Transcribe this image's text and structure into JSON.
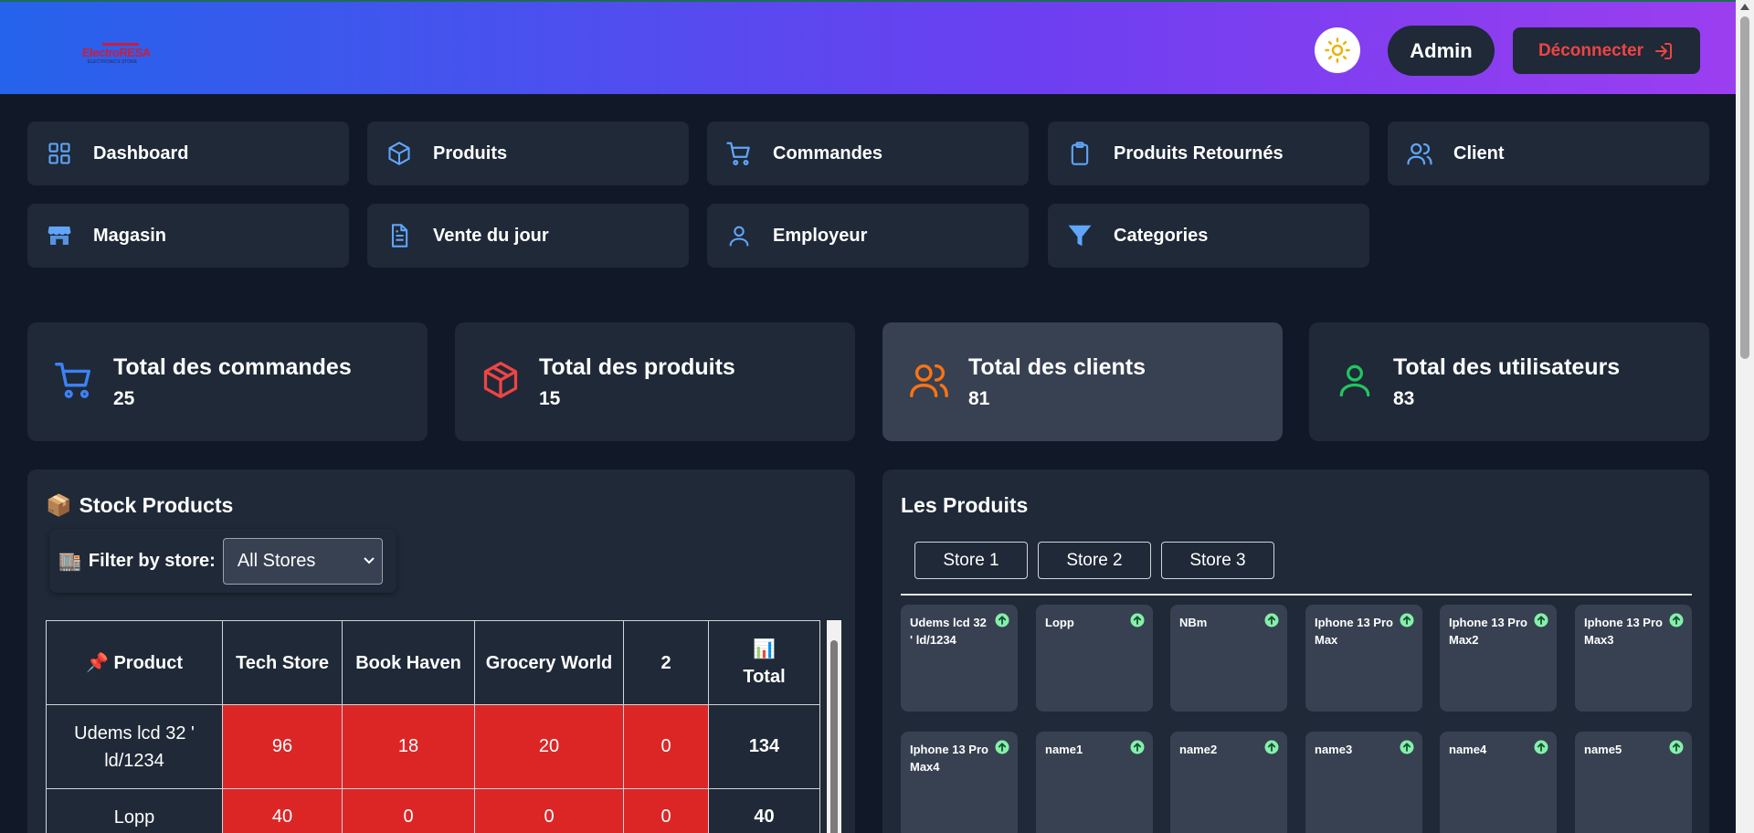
{
  "header": {
    "logo_text": "ElectroRESA",
    "logo_sub": "ELECTRONICS STORE",
    "admin_label": "Admin",
    "logout_label": "Déconnecter"
  },
  "nav": [
    {
      "label": "Dashboard",
      "icon": "grid-icon"
    },
    {
      "label": "Produits",
      "icon": "box-icon"
    },
    {
      "label": "Commandes",
      "icon": "cart-icon"
    },
    {
      "label": "Produits Retournés",
      "icon": "clipboard-icon"
    },
    {
      "label": "Client",
      "icon": "users-icon"
    },
    {
      "label": "Magasin",
      "icon": "store-icon"
    },
    {
      "label": "Vente du jour",
      "icon": "document-icon"
    },
    {
      "label": "Employeur",
      "icon": "user-icon"
    },
    {
      "label": "Categories",
      "icon": "filter-icon"
    }
  ],
  "stats": [
    {
      "title": "Total des commandes",
      "value": "25",
      "icon": "cart-icon",
      "color": "#3b82f6"
    },
    {
      "title": "Total des produits",
      "value": "15",
      "icon": "box-icon",
      "color": "#ef4444"
    },
    {
      "title": "Total des clients",
      "value": "81",
      "icon": "users-icon",
      "color": "#f97316"
    },
    {
      "title": "Total des utilisateurs",
      "value": "83",
      "icon": "user-icon",
      "color": "#22c55e"
    }
  ],
  "stock": {
    "title": "Stock Products",
    "title_emoji": "📦",
    "filter_emoji": "🏬",
    "filter_label": "Filter by store:",
    "filter_value": "All Stores",
    "headers": [
      "Product",
      "Tech Store",
      "Book Haven",
      "Grocery World",
      "2",
      "Total"
    ],
    "product_emoji": "📌",
    "total_emoji": "📊",
    "rows": [
      {
        "product": "Udems lcd 32 ' ld/1234",
        "values": [
          "96",
          "18",
          "20",
          "0"
        ],
        "total": "134"
      },
      {
        "product": "Lopp",
        "values": [
          "40",
          "0",
          "0",
          "0"
        ],
        "total": "40"
      }
    ]
  },
  "products": {
    "title": "Les Produits",
    "tabs": [
      "Store 1",
      "Store 2",
      "Store 3"
    ],
    "cards": [
      "Udems lcd 32 ' ld/1234",
      "Lopp",
      "NBm",
      "Iphone 13 Pro Max",
      "Iphone 13 Pro Max2",
      "Iphone 13 Pro Max3",
      "Iphone 13 Pro Max4",
      "name1",
      "name2",
      "name3",
      "name4",
      "name5"
    ]
  }
}
